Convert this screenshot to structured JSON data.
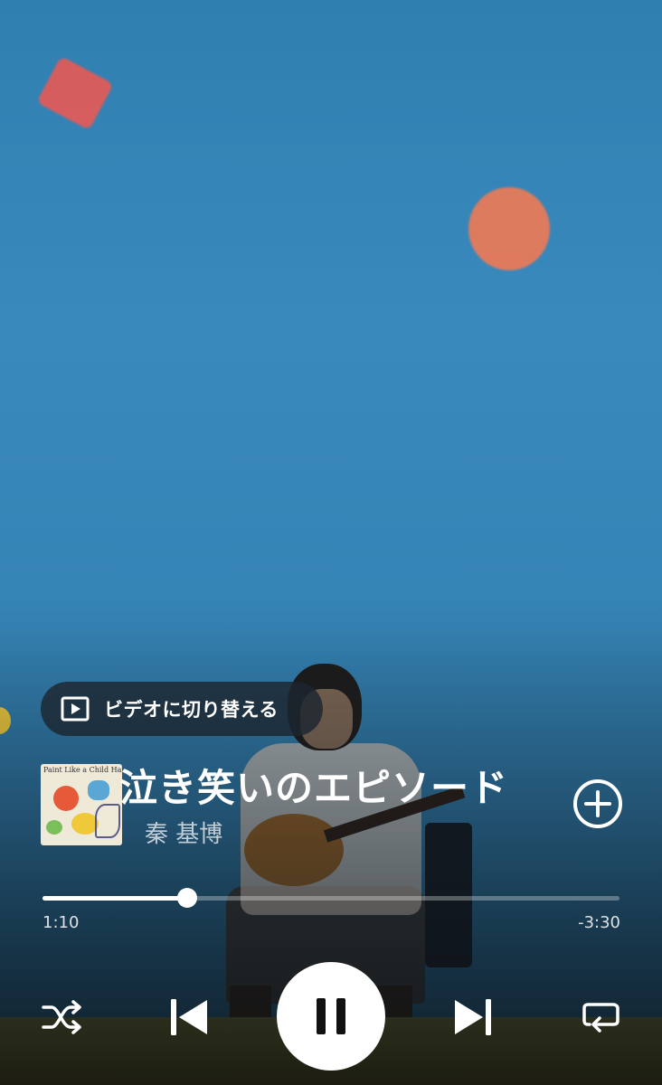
{
  "player": {
    "video_toggle_label": "ビデオに切り替える",
    "song_title": "泣き笑いのエピソード",
    "artist": "秦 基博",
    "album_art_text": "Paint Like a Child  Hata Motohiro",
    "progress": {
      "elapsed": "1:10",
      "remaining": "-3:30",
      "fraction": 0.25
    },
    "state": "playing"
  },
  "icons": {
    "video": "play-box-icon",
    "add": "plus-circle-icon",
    "shuffle": "shuffle-icon",
    "previous": "skip-previous-icon",
    "pause": "pause-icon",
    "next": "skip-next-icon",
    "repeat": "repeat-icon"
  },
  "colors": {
    "sky": "#3586b8",
    "accent": "#ffffff"
  }
}
